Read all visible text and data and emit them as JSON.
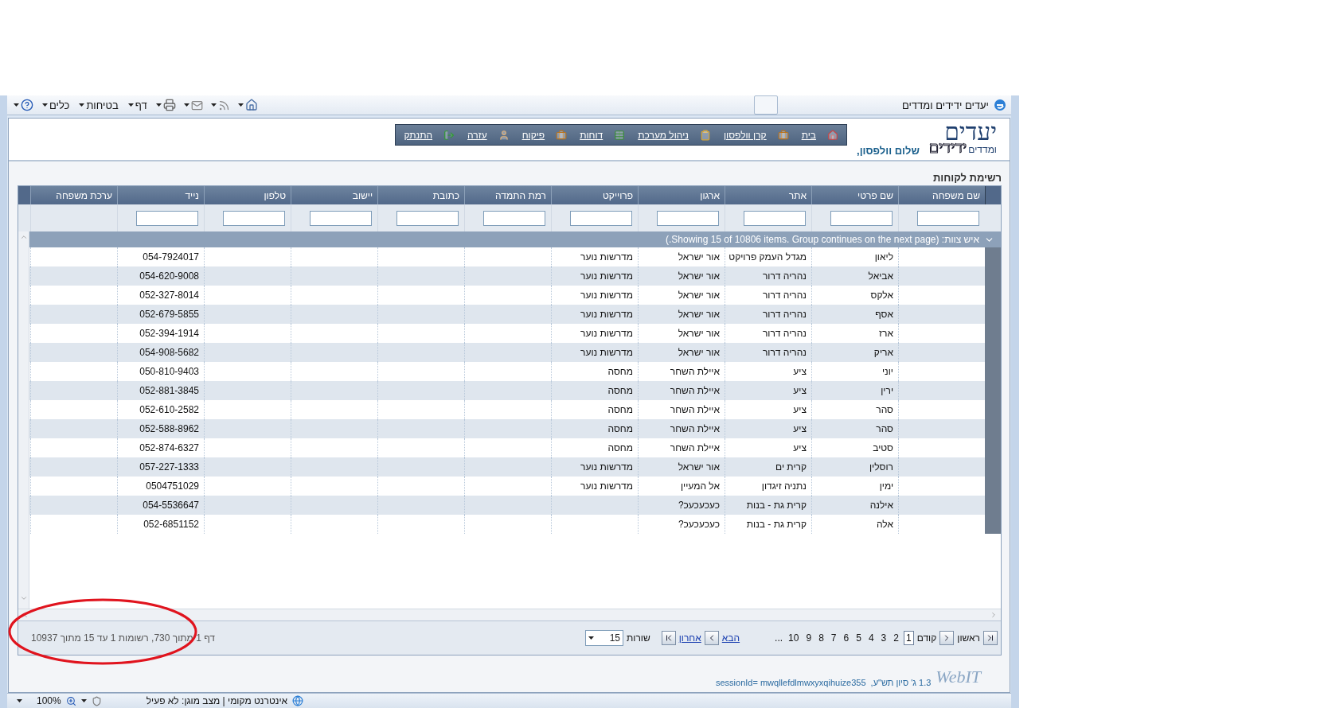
{
  "browser": {
    "title": "יעדים ידידים ומדדים",
    "menus": [
      {
        "label": "דף"
      },
      {
        "label": "בטיחות"
      },
      {
        "label": "כלים"
      }
    ]
  },
  "header": {
    "logo_main": "יעדים",
    "logo_sub": "ומדדים",
    "logo_accent": "ידידים",
    "greeting": "שלום וולפסון,",
    "nav": [
      {
        "label": "בית"
      },
      {
        "label": "קרן וולפסון"
      },
      {
        "label": "ניהול מערכת"
      },
      {
        "label": "דוחות"
      },
      {
        "label": "פיקוח"
      },
      {
        "label": "עזרה"
      },
      {
        "label": "התנתק"
      }
    ]
  },
  "page_title": "רשימת לקוחות",
  "table": {
    "columns": [
      {
        "label": "שם משפחה",
        "filter": true
      },
      {
        "label": "שם פרטי",
        "filter": true
      },
      {
        "label": "אתר",
        "filter": true
      },
      {
        "label": "ארגון",
        "filter": true
      },
      {
        "label": "פרוייקט",
        "filter": true
      },
      {
        "label": "רמת התמדה",
        "filter": true
      },
      {
        "label": "כתובת",
        "filter": true
      },
      {
        "label": "יישוב",
        "filter": true
      },
      {
        "label": "טלפון",
        "filter": true
      },
      {
        "label": "נייד",
        "filter": true
      },
      {
        "label": "ערכת משפחה",
        "filter": false
      }
    ],
    "group": "איש צוות: (Showing 15 of 10806 items. Group continues on the next page.)",
    "rows": [
      {
        "first_name": "ליאון",
        "site": "מגדל העמק פרויקט",
        "organization": "אור ישראל",
        "project": "מדרשות נוער",
        "mobile": "054-7924017"
      },
      {
        "first_name": "אביאל",
        "site": "נהריה דרור",
        "organization": "אור ישראל",
        "project": "מדרשות נוער",
        "mobile": "054-620-9008"
      },
      {
        "first_name": "אלקס",
        "site": "נהריה דרור",
        "organization": "אור ישראל",
        "project": "מדרשות נוער",
        "mobile": "052-327-8014"
      },
      {
        "first_name": "אסף",
        "site": "נהריה דרור",
        "organization": "אור ישראל",
        "project": "מדרשות נוער",
        "mobile": "052-679-5855"
      },
      {
        "first_name": "ארז",
        "site": "נהריה דרור",
        "organization": "אור ישראל",
        "project": "מדרשות נוער",
        "mobile": "052-394-1914"
      },
      {
        "first_name": "אריק",
        "site": "נהריה דרור",
        "organization": "אור ישראל",
        "project": "מדרשות נוער",
        "mobile": "054-908-5682"
      },
      {
        "first_name": "יוני",
        "site": "ציע",
        "organization": "איילת השחר",
        "project": "מחסה",
        "mobile": "050-810-9403"
      },
      {
        "first_name": "ירין",
        "site": "ציע",
        "organization": "איילת השחר",
        "project": "מחסה",
        "mobile": "052-881-3845"
      },
      {
        "first_name": "סהר",
        "site": "ציע",
        "organization": "איילת השחר",
        "project": "מחסה",
        "mobile": "052-610-2582"
      },
      {
        "first_name": "סהר",
        "site": "ציע",
        "organization": "איילת השחר",
        "project": "מחסה",
        "mobile": "052-588-8962"
      },
      {
        "first_name": "סטיב",
        "site": "ציע",
        "organization": "איילת השחר",
        "project": "מחסה",
        "mobile": "052-874-6327"
      },
      {
        "first_name": "רוסלין",
        "site": "קרית ים",
        "organization": "אור ישראל",
        "project": "מדרשות נוער",
        "mobile": "057-227-1333"
      },
      {
        "first_name": "ימין",
        "site": "נתניה זיגדון",
        "organization": "אל המעיין",
        "project": "מדרשות נוער",
        "mobile": "0504751029"
      },
      {
        "first_name": "אילנה",
        "site": "קרית גת - בנות",
        "organization": "כעכעכעכ?",
        "mobile": "054-5536647"
      },
      {
        "first_name": "אלה",
        "site": "קרית גת - בנות",
        "organization": "כעכעכעכ?",
        "mobile": "052-6851152"
      }
    ],
    "pager": {
      "first": "ראשון",
      "prev": "קודם",
      "pages": [
        {
          "label": "1",
          "selected": true
        },
        {
          "label": "2",
          "selected": false
        },
        {
          "label": "3",
          "selected": false
        },
        {
          "label": "4",
          "selected": false
        },
        {
          "label": "5",
          "selected": false
        },
        {
          "label": "6",
          "selected": false
        },
        {
          "label": "7",
          "selected": false
        },
        {
          "label": "8",
          "selected": false
        },
        {
          "label": "9",
          "selected": false
        },
        {
          "label": "10",
          "selected": false
        }
      ],
      "more": "...",
      "next": "הבא",
      "last": "אחרון",
      "rows_label": "שורות",
      "rows_value": "15",
      "info": "דף 1 מתוך 730, רשומות 1 עד 15 מתוך 10937"
    }
  },
  "annotations": [
    {
      "kind": "ellipse"
    }
  ],
  "footer": {
    "logo": "WebIT",
    "version": "1.3 ג' סיון תש\"ע,",
    "session": "sessionId= mwqllefdlmwxyxqihuize355"
  },
  "status_bar": {
    "zone": "אינטרנט מקומי | מצב מוגן: לא פעיל",
    "zoom": "100%"
  }
}
